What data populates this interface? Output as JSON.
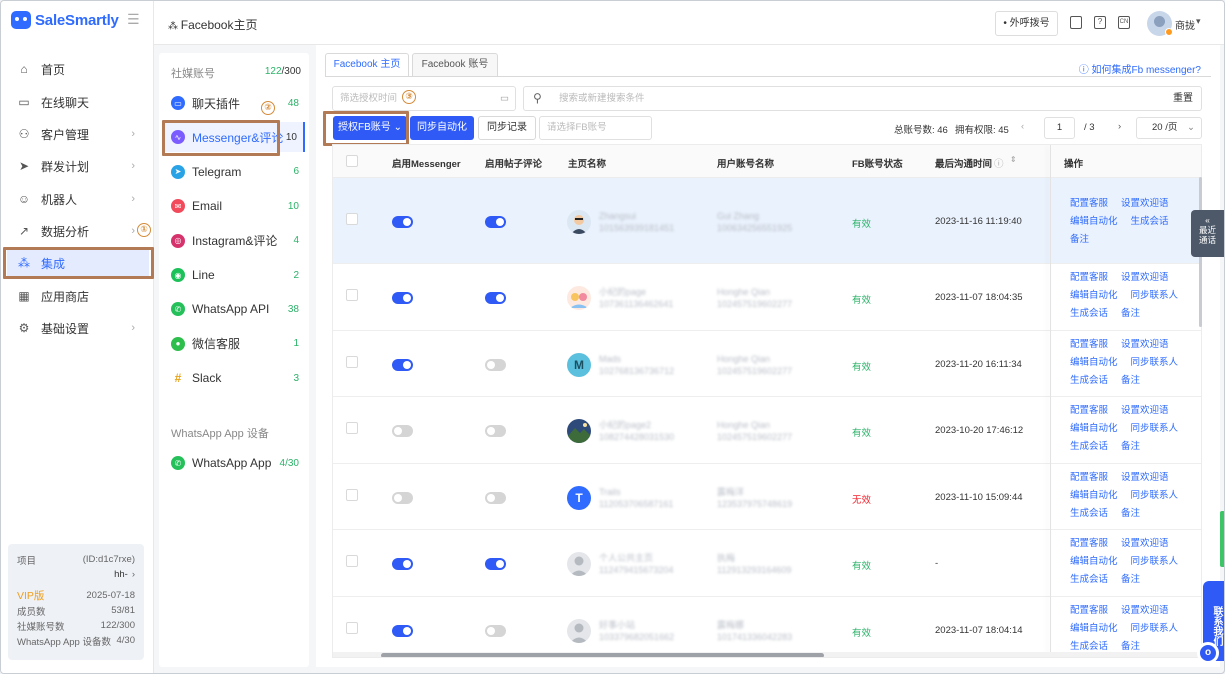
{
  "app": {
    "brand": "SaleSmartly"
  },
  "nav": {
    "items": [
      {
        "label": "首页",
        "icon": "home-icon",
        "chevron": false
      },
      {
        "label": "在线聊天",
        "icon": "chat-icon",
        "chevron": false
      },
      {
        "label": "客户管理",
        "icon": "users-icon",
        "chevron": true
      },
      {
        "label": "群发计划",
        "icon": "send-icon",
        "chevron": true
      },
      {
        "label": "机器人",
        "icon": "robot-icon",
        "chevron": true
      },
      {
        "label": "数据分析",
        "icon": "chart-icon",
        "chevron": true
      },
      {
        "label": "集成",
        "icon": "integration-icon",
        "chevron": false
      },
      {
        "label": "应用商店",
        "icon": "apps-icon",
        "chevron": false
      },
      {
        "label": "基础设置",
        "icon": "gear-icon",
        "chevron": true
      }
    ],
    "active_index": 6
  },
  "annotations": {
    "n1": "①",
    "n2": "②",
    "n3": "③"
  },
  "project": {
    "label": "项目",
    "id": "(ID:d1c7rxe)",
    "owner": "hh-",
    "vip_label": "VIP版",
    "vip_date": "2025-07-18",
    "rows": [
      {
        "k": "成员数",
        "v": "53/81"
      },
      {
        "k": "社媒账号数",
        "v": "122/300"
      },
      {
        "k": "WhatsApp App 设备数",
        "v": "4/30"
      }
    ]
  },
  "header": {
    "breadcrumb": "Facebook主页",
    "call_btn": "• 外呼拨号",
    "user": "商拢"
  },
  "social": {
    "title": "社媒账号",
    "used": "122",
    "total": "/300",
    "items": [
      {
        "label": "聊天插件",
        "count": "48",
        "color": "#2f6bff",
        "icon": "chat-plugin-icon"
      },
      {
        "label": "Messenger&评论",
        "count": "10",
        "color": "#7b5cff",
        "icon": "messenger-icon"
      },
      {
        "label": "Telegram",
        "count": "6",
        "color": "#2aa3e6",
        "icon": "telegram-icon"
      },
      {
        "label": "Email",
        "count": "10",
        "color": "#f24a5b",
        "icon": "email-icon"
      },
      {
        "label": "Instagram&评论",
        "count": "4",
        "color": "#d6336c",
        "icon": "instagram-icon"
      },
      {
        "label": "Line",
        "count": "2",
        "color": "#1dc15a",
        "icon": "line-icon"
      },
      {
        "label": "WhatsApp API",
        "count": "38",
        "color": "#25c05a",
        "icon": "whatsapp-icon"
      },
      {
        "label": "微信客服",
        "count": "1",
        "color": "#2dbe4c",
        "icon": "wechat-icon"
      },
      {
        "label": "Slack",
        "count": "3",
        "color": "#e8a31b",
        "icon": "slack-icon"
      }
    ],
    "device_title": "WhatsApp App 设备",
    "device_item": {
      "label": "WhatsApp App",
      "count": "4/30"
    }
  },
  "main": {
    "tabs": [
      "Facebook 主页",
      "Facebook 账号"
    ],
    "help": "如何集成Fb messenger?",
    "filter_time_placeholder": "筛选授权时间",
    "search_placeholder": "搜索或新建搜索条件",
    "reset": "重置",
    "btn_auth": "授权FB账号",
    "btn_sync_auto": "同步自动化",
    "btn_sync_log": "同步记录",
    "select_placeholder": "请选择FB账号",
    "total_label": "总账号数: 46",
    "perm_label": "拥有权限: 45",
    "page_current": "1",
    "page_total": "/ 3",
    "page_size": "20 /页"
  },
  "table": {
    "columns": [
      "启用Messenger",
      "启用帖子评论",
      "主页名称",
      "用户账号名称",
      "FB账号状态",
      "最后沟通时间",
      "操作"
    ],
    "rows": [
      {
        "messenger": true,
        "comment": true,
        "page": "Zhangsui",
        "pid": "101563939181451",
        "user": "Gui Zhang",
        "uid": "100634256551925",
        "status": "有效",
        "time": "2023-11-16 11:19:40",
        "ops": [
          "配置客服",
          "设置欢迎语",
          "编辑自动化",
          "生成会话",
          "备注"
        ],
        "avatar": "person",
        "selected": true
      },
      {
        "messenger": true,
        "comment": true,
        "page": "小纪的page",
        "pid": "107361136462641",
        "user": "Honghe Qian",
        "uid": "102457519602277",
        "status": "有效",
        "time": "2023-11-07 18:04:35",
        "ops": [
          "配置客服",
          "设置欢迎语",
          "编辑自动化",
          "同步联系人",
          "生成会话",
          "备注"
        ],
        "avatar": "cartoon"
      },
      {
        "messenger": true,
        "comment": false,
        "page": "Mads",
        "pid": "102768136736712",
        "user": "Honghe Qian",
        "uid": "102457519602277",
        "status": "有效",
        "time": "2023-11-20 16:11:34",
        "ops": [
          "配置客服",
          "设置欢迎语",
          "编辑自动化",
          "同步联系人",
          "生成会话",
          "备注"
        ],
        "avatar": "M"
      },
      {
        "messenger": false,
        "comment": false,
        "page": "小纪的page2",
        "pid": "108274428031530",
        "user": "Honghe Qian",
        "uid": "102457519602277",
        "status": "有效",
        "time": "2023-10-20 17:46:12",
        "ops": [
          "配置客服",
          "设置欢迎语",
          "编辑自动化",
          "同步联系人",
          "生成会话",
          "备注"
        ],
        "avatar": "mountain"
      },
      {
        "messenger": false,
        "comment": false,
        "page": "Trails",
        "pid": "112053706587161",
        "user": "露梅洋",
        "uid": "123537975748619",
        "status": "无效",
        "time": "2023-11-10 15:09:44",
        "ops": [
          "配置客服",
          "设置欢迎语",
          "编辑自动化",
          "同步联系人",
          "生成会话",
          "备注"
        ],
        "avatar": "T"
      },
      {
        "messenger": true,
        "comment": true,
        "page": "个人公共主页",
        "pid": "112479415673204",
        "user": "执梅",
        "uid": "112913293164609",
        "status": "有效",
        "time": "-",
        "ops": [
          "配置客服",
          "设置欢迎语",
          "编辑自动化",
          "同步联系人",
          "生成会话",
          "备注"
        ],
        "avatar": "blank"
      },
      {
        "messenger": true,
        "comment": false,
        "page": "好事小站",
        "pid": "103379682051662",
        "user": "露梅娜",
        "uid": "101741336042283",
        "status": "有效",
        "time": "2023-11-07 18:04:14",
        "ops": [
          "配置客服",
          "设置欢迎语",
          "编辑自动化",
          "同步联系人",
          "生成会话",
          "备注"
        ],
        "avatar": "blank"
      }
    ]
  },
  "side": {
    "recent_calls": "最近通话",
    "contact": "联系我们"
  },
  "colors": {
    "primary": "#2f5af5",
    "valid": "#2ab368",
    "invalid": "#f5222d",
    "annotation": "#b27a55"
  }
}
